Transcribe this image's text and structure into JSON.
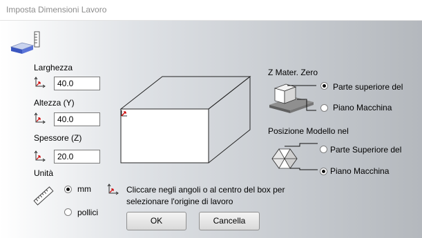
{
  "window": {
    "title": "Imposta Dimensioni Lavoro"
  },
  "dimensions": {
    "width": {
      "label": "Larghezza",
      "value": "40.0"
    },
    "height": {
      "label": "Altezza (Y)",
      "value": "40.0"
    },
    "thickness": {
      "label": "Spessore (Z)",
      "value": "20.0"
    }
  },
  "units": {
    "label": "Unità",
    "options": [
      "mm",
      "pollici"
    ],
    "selected": "mm"
  },
  "z_zero": {
    "label": "Z Mater. Zero",
    "options": [
      "Parte superiore del",
      "Piano Macchina"
    ],
    "selected": "Parte superiore del"
  },
  "model_position": {
    "label": "Posizione Modello nel",
    "options": [
      "Parte Superiore del",
      "Piano Macchina"
    ],
    "selected": "Piano Macchina"
  },
  "hint": {
    "line1": "Cliccare negli angoli o al centro del box per",
    "line2": "selezionare l'origine di lavoro"
  },
  "buttons": {
    "ok": "OK",
    "cancel": "Cancella"
  },
  "colors": {
    "origin_marker": "#cc0000",
    "title_text": "#8c8c8c"
  },
  "icons": [
    "job-size-icon",
    "axis-origin-icon",
    "ruler-icon",
    "material-top-icon",
    "model-position-icon"
  ]
}
